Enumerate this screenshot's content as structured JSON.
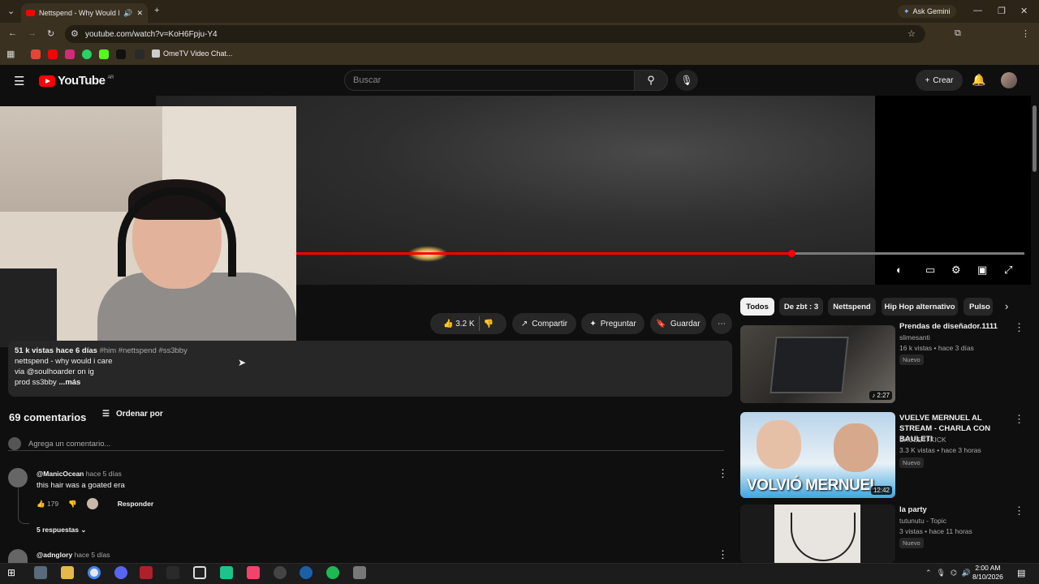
{
  "browser": {
    "tab_title": "Nettspend - Why Would I C",
    "url": "youtube.com/watch?v=KoH6Fpju-Y4",
    "ask_gemini": "Ask Gemini",
    "bookmark_label": "OmeTV Video Chat..."
  },
  "header": {
    "logo_text": "YouTube",
    "region": "AR",
    "search_placeholder": "Buscar",
    "create_label": "Crear"
  },
  "actions": {
    "likes": "3.2 K",
    "share": "Compartir",
    "ask": "Preguntar",
    "save": "Guardar"
  },
  "description": {
    "stats": "51 k vistas  hace 6 días",
    "tags": "#him #nettspend #ss3bby",
    "line1": "nettspend - why would i care",
    "line2": "via @soulhoarder on ig",
    "line3": "prod ss3bby",
    "more": "...más"
  },
  "comments": {
    "count": "69 comentarios",
    "sort": "Ordenar por",
    "add_placeholder": "Agrega un comentario...",
    "items": [
      {
        "author": "@ManicOcean",
        "time": "hace 5 días",
        "text": "this hair was a goated era",
        "likes": "179",
        "reply": "Responder",
        "replies": "5 respuestas"
      },
      {
        "author": "@adnglory",
        "time": "hace 5 días"
      }
    ]
  },
  "chips": [
    "Todos",
    "De zbt : 3",
    "Nettspend",
    "Hip Hop alternativo",
    "Pulso"
  ],
  "sidebar": [
    {
      "title": "Prendas de diseñador.1111",
      "channel": "slimesanti",
      "meta": "16 k vistas • hace 3 días",
      "badge": "Nuevo",
      "duration": "2:27"
    },
    {
      "title": "VUELVE MERNUEL AL STREAM - CHARLA CON BAULETI",
      "channel": "BAULETI KICK",
      "meta": "3.3 K vistas • hace 3 horas",
      "badge": "Nuevo",
      "duration": "12:42",
      "thumb_text": "VOLVIÓ MERNUEL"
    },
    {
      "title": "la party",
      "channel": "tutunutu - Topic",
      "meta": "3 vistas • hace 11 horas",
      "badge": "Nuevo"
    }
  ],
  "taskbar": {
    "time": "2:00 AM",
    "date": "8/10/2026"
  },
  "player": {
    "progress_fraction": 0.68
  },
  "colors": {
    "accent": "#ff0000",
    "background": "#0f0f0f"
  }
}
